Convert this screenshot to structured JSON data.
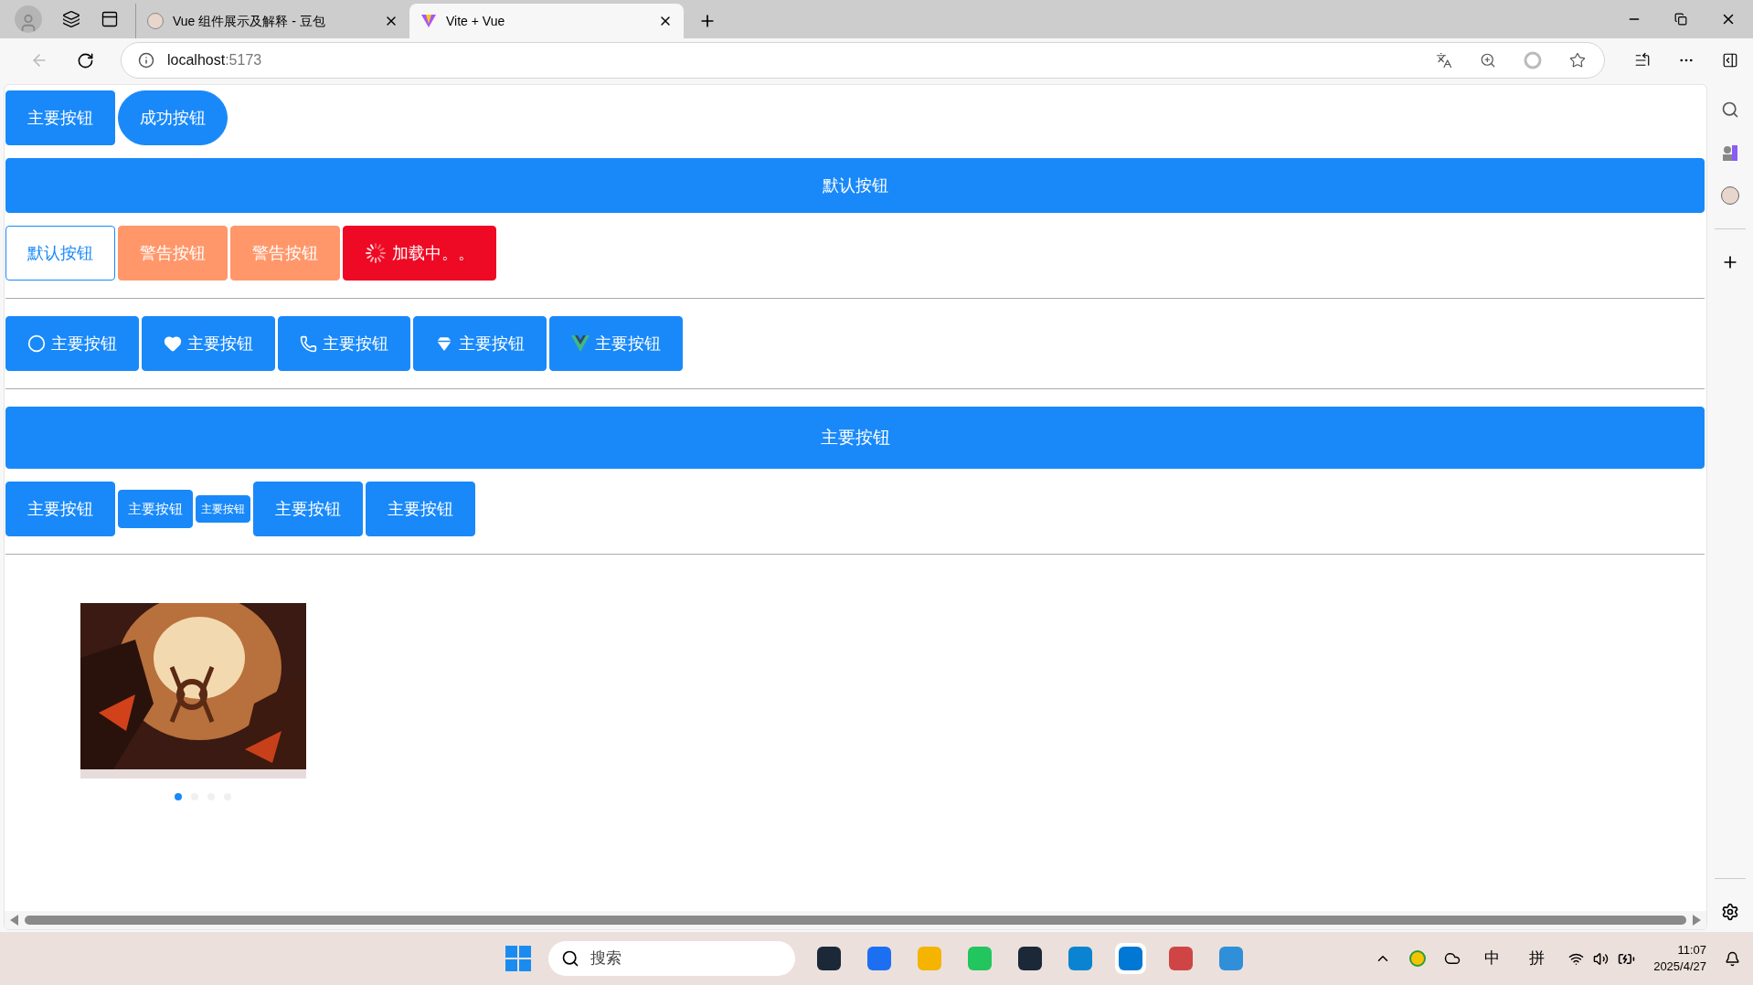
{
  "browser": {
    "tabs": [
      {
        "title": "Vue 组件展示及解释 - 豆包",
        "selected": false
      },
      {
        "title": "Vite + Vue",
        "selected": true
      }
    ],
    "address": {
      "host": "localhost",
      "port": ":5173"
    }
  },
  "sections": [
    {
      "divider": true,
      "rows": [
        [
          {
            "label": "主要按钮",
            "kind": "primary"
          },
          {
            "label": "成功按钮",
            "kind": "round"
          }
        ],
        [
          {
            "label": "默认按钮",
            "kind": "block"
          }
        ],
        [
          {
            "label": "默认按钮",
            "kind": "plain"
          },
          {
            "label": "警告按钮",
            "kind": "warning"
          },
          {
            "label": "警告按钮",
            "kind": "warning"
          },
          {
            "label": "加载中。。",
            "kind": "loading"
          }
        ]
      ]
    },
    {
      "divider": true,
      "rows": [
        [
          {
            "label": "主要按钮",
            "kind": "circle"
          },
          {
            "label": "主要按钮",
            "kind": "heart"
          },
          {
            "label": "主要按钮",
            "kind": "phone"
          },
          {
            "label": "主要按钮",
            "kind": "diamond"
          },
          {
            "label": "主要按钮",
            "kind": "vue"
          }
        ]
      ]
    },
    {
      "divider": true,
      "rows": [
        [
          {
            "label": "主要按钮",
            "kind": "large"
          }
        ],
        [
          {
            "label": "主要按钮",
            "kind": "primary"
          },
          {
            "label": "主要按钮",
            "kind": "small"
          },
          {
            "label": "主要按钮",
            "kind": "mini"
          },
          {
            "label": "主要按钮",
            "kind": "primary"
          },
          {
            "label": "主要按钮",
            "kind": "primary"
          }
        ]
      ]
    }
  ],
  "carousel": {
    "dots": [
      {
        "selected": true
      },
      {
        "selected": false
      },
      {
        "selected": false
      },
      {
        "selected": false
      }
    ]
  },
  "taskbar": {
    "search": {
      "placeholder": "搜索"
    },
    "ime": [
      "中",
      "拼"
    ],
    "time": "11:07",
    "date": "2025/4/27"
  }
}
